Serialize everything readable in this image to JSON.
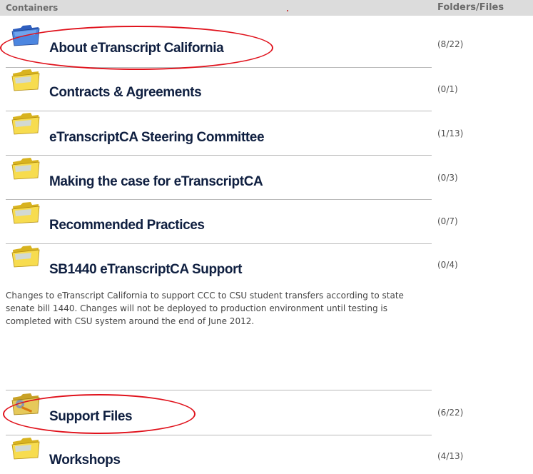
{
  "header": {
    "containers_label": "Containers",
    "folders_label": "Folders/Files"
  },
  "items": [
    {
      "title": "About eTranscript California",
      "count": "(8/22)",
      "icon": "folder-blue-icon"
    },
    {
      "title": "Contracts & Agreements",
      "count": "(0/1)",
      "icon": "folder-icon"
    },
    {
      "title": "eTranscriptCA Steering Committee",
      "count": "(1/13)",
      "icon": "folder-icon"
    },
    {
      "title": "Making the case for eTranscriptCA",
      "count": "(0/3)",
      "icon": "folder-icon"
    },
    {
      "title": "Recommended Practices",
      "count": "(0/7)",
      "icon": "folder-icon"
    },
    {
      "title": "SB1440 eTranscriptCA Support",
      "count": "(0/4)",
      "icon": "folder-icon"
    },
    {
      "title": "Support Files",
      "count": "(6/22)",
      "icon": "support-folder-icon"
    },
    {
      "title": "Workshops",
      "count": "(4/13)",
      "icon": "folder-icon"
    }
  ],
  "description": "Changes to eTranscript California to support CCC to CSU student transfers according to state senate bill 1440. Changes will not be deployed to production environment until testing is completed with CSU system around the end of June 2012.",
  "annotations": {
    "highlight_color": "#e0121c"
  }
}
